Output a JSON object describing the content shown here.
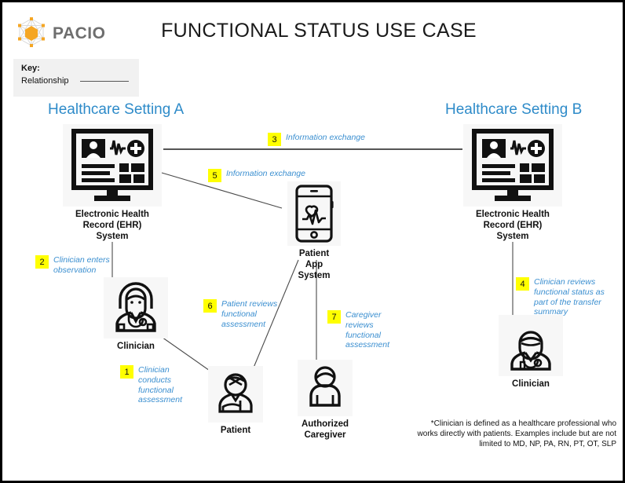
{
  "header": {
    "logo_text": "PACIO",
    "logo_icon": "pacio-hexagon-network-logo",
    "title": "FUNCTIONAL STATUS USE CASE",
    "brand_color": "#f5a623"
  },
  "key": {
    "title": "Key:",
    "relationship_label": "Relationship"
  },
  "settings": {
    "a_title": "Healthcare Setting A",
    "b_title": "Healthcare Setting B",
    "title_color": "#2e8bc9"
  },
  "nodes": {
    "ehr_a": {
      "label": "Electronic Health\nRecord (EHR)\nSystem",
      "icon": "ehr-monitor-icon"
    },
    "ehr_b": {
      "label": "Electronic Health\nRecord (EHR)\nSystem",
      "icon": "ehr-monitor-icon"
    },
    "clinician_a": {
      "label": "Clinician",
      "icon": "female-clinician-icon"
    },
    "clinician_b": {
      "label": "Clinician",
      "icon": "male-clinician-icon"
    },
    "patient_app": {
      "label": "Patient\nApp\nSystem",
      "icon": "smartphone-heart-ecg-icon"
    },
    "patient": {
      "label": "Patient",
      "icon": "injured-patient-icon"
    },
    "caregiver": {
      "label": "Authorized\nCaregiver",
      "icon": "person-caregiver-icon"
    }
  },
  "steps": [
    {
      "num": "1",
      "text": "Clinician conducts functional assessment"
    },
    {
      "num": "2",
      "text": "Clinician enters observation"
    },
    {
      "num": "3",
      "text": "Information exchange"
    },
    {
      "num": "4",
      "text": "Clinician reviews functional status as part of the transfer summary"
    },
    {
      "num": "5",
      "text": "Information exchange"
    },
    {
      "num": "6",
      "text": "Patient reviews functional assessment"
    },
    {
      "num": "7",
      "text": "Caregiver reviews functional assessment"
    }
  ],
  "footnote": "*Clinician is defined as a healthcare professional who works directly with patients. Examples include but are not limited to MD, NP, PA, RN, PT, OT, SLP",
  "colors": {
    "step_badge": "#ffff00",
    "step_text": "#3b8fd0",
    "line": "#4a4a4a",
    "border": "#000000"
  }
}
